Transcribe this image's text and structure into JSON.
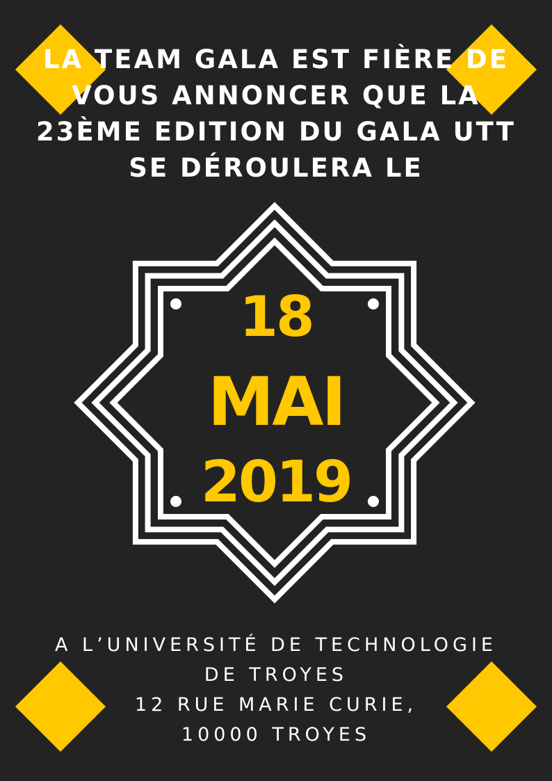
{
  "colors": {
    "background": "#232323",
    "accent": "#ffc800",
    "text": "#ffffff"
  },
  "headline": {
    "lines": [
      "LA TEAM GALA EST FIÈRE DE",
      "VOUS ANNONCER QUE LA",
      "23ÈME EDITION DU GALA UTT",
      "SE DÉROULERA LE"
    ]
  },
  "event_date": {
    "day": "18",
    "month": "MAI",
    "year": "2019"
  },
  "location": {
    "lines": [
      "A L’UNIVERSITÉ DE TECHNOLOGIE",
      "DE TROYES",
      "12 RUE MARIE CURIE,",
      "10000 TROYES"
    ]
  },
  "decorations": {
    "corner_shape": "yellow-diamond",
    "badge_shape": "octagram-frame"
  }
}
